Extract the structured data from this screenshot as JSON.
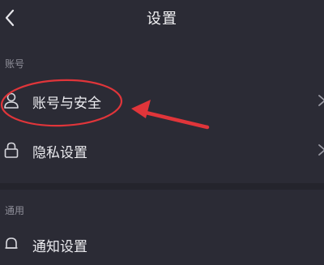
{
  "header": {
    "title": "设置"
  },
  "sections": [
    {
      "label": "账号"
    },
    {
      "label": "通用"
    }
  ],
  "rows": {
    "account_security": "账号与安全",
    "privacy_settings": "隐私设置",
    "notification_settings": "通知设置"
  },
  "icons": {
    "back": "chevron-left-icon",
    "account": "user-icon",
    "privacy": "lock-icon",
    "notification": "bell-icon",
    "row_arrow": "chevron-right-icon"
  },
  "colors": {
    "background": "#2b2b35",
    "text": "#ececf0",
    "section_text": "#8f8f99",
    "annotation_red": "#e0353a"
  }
}
